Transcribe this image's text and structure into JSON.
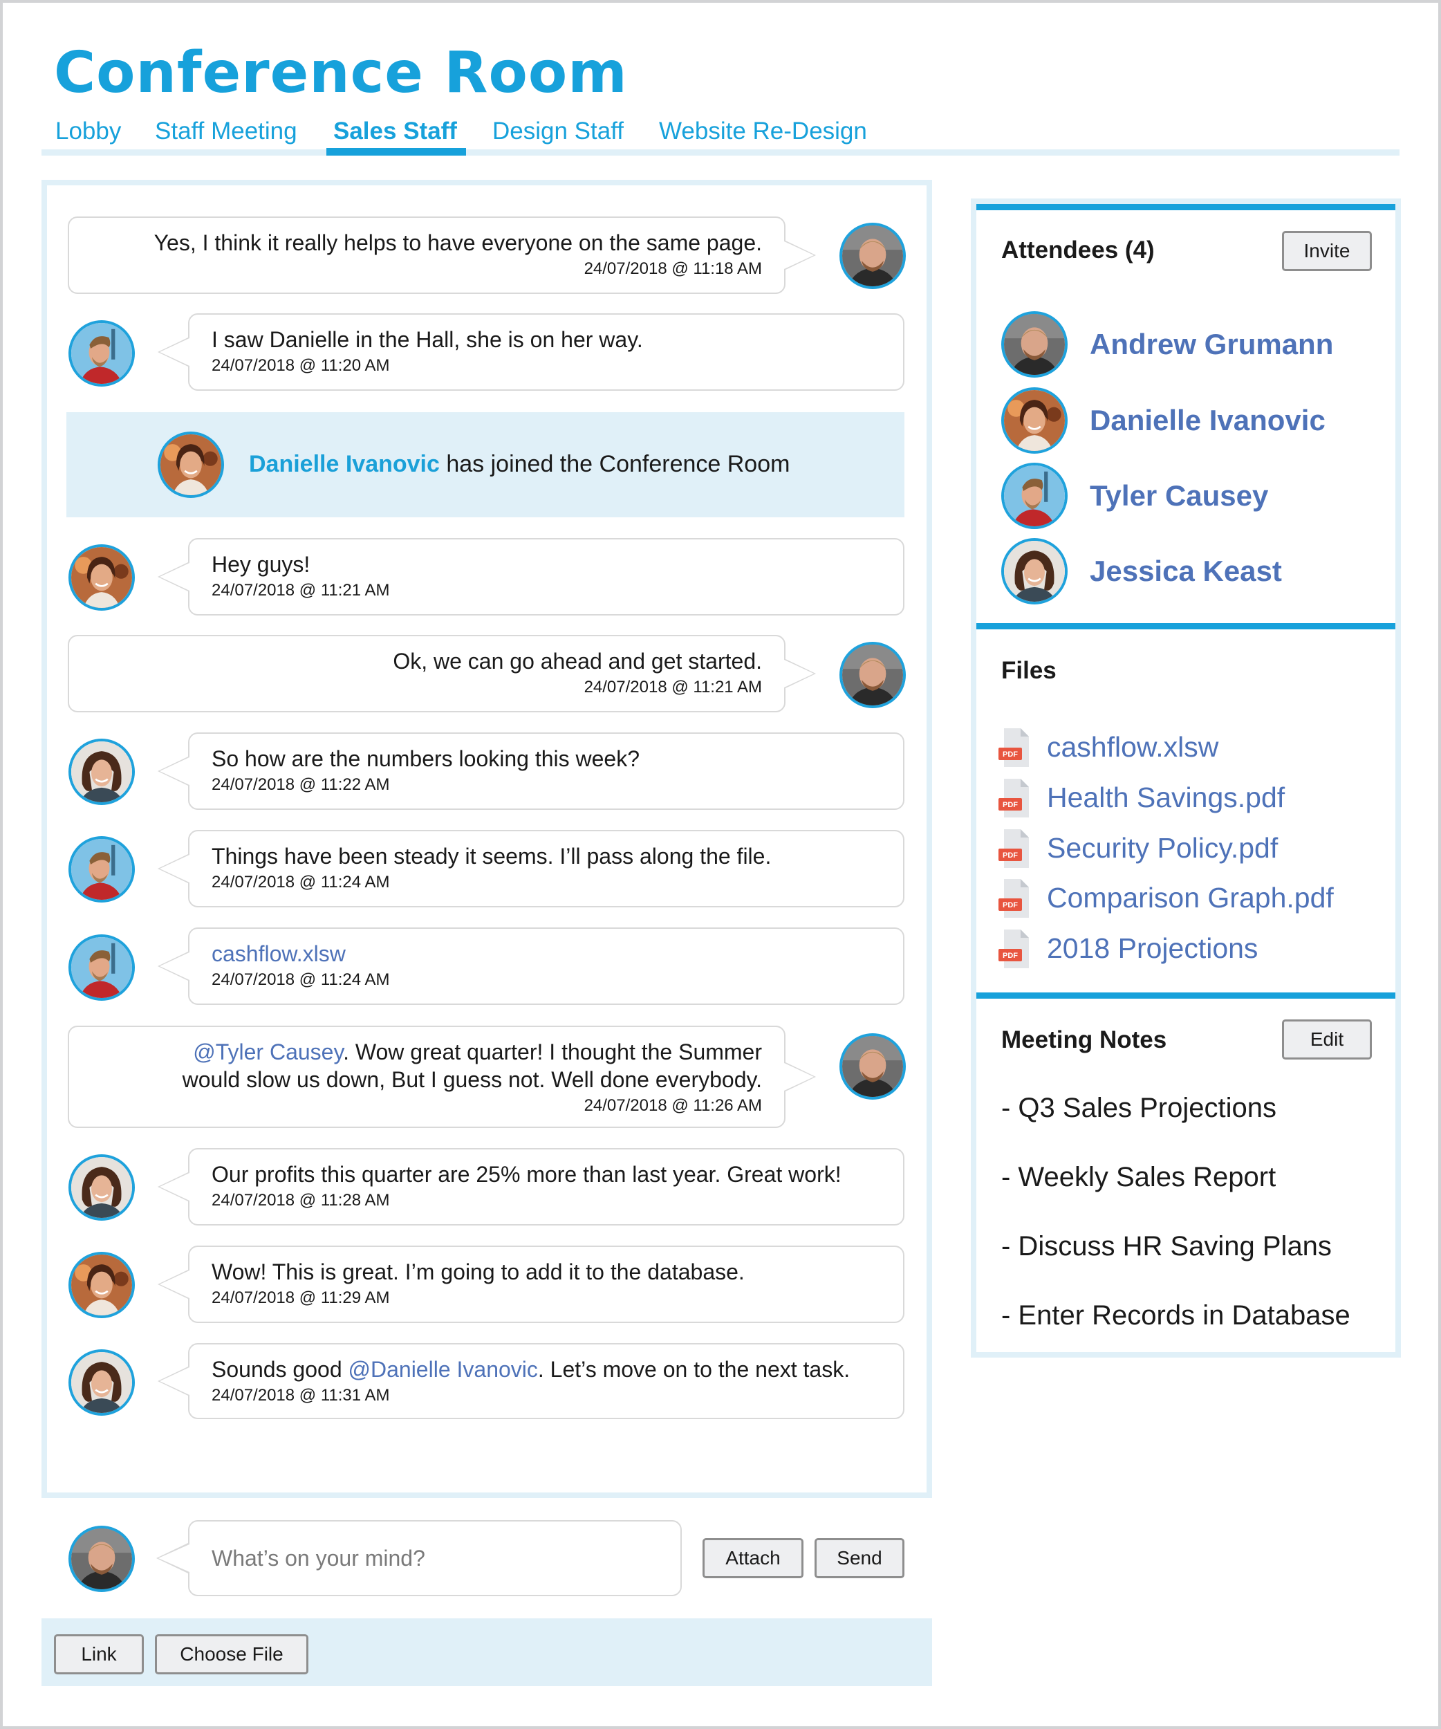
{
  "header": {
    "title": "Conference Room"
  },
  "tabs": [
    {
      "label": "Lobby",
      "active": false
    },
    {
      "label": "Staff Meeting",
      "active": false
    },
    {
      "label": "Sales Staff",
      "active": true
    },
    {
      "label": "Design Staff",
      "active": false
    },
    {
      "label": "Website Re-Design",
      "active": false
    }
  ],
  "colors": {
    "accent": "#17a1db",
    "link": "#4e72b8",
    "panel_bg": "#e0f0f8",
    "bubble_border": "#d9d9d9",
    "button_bg": "#eeeff1",
    "pdf_badge": "#e8553f"
  },
  "people": {
    "andrew": {
      "name": "Andrew Grumann",
      "avatar": "avatar-andrew"
    },
    "danielle": {
      "name": "Danielle Ivanovic",
      "avatar": "avatar-danielle"
    },
    "tyler": {
      "name": "Tyler Causey",
      "avatar": "avatar-tyler"
    },
    "jessica": {
      "name": "Jessica Keast",
      "avatar": "avatar-jessica"
    }
  },
  "messages": [
    {
      "author": "andrew",
      "side": "right",
      "text": "Yes, I think it really helps to have everyone on the same page.",
      "time": "24/07/2018  @ 11:18 AM"
    },
    {
      "author": "tyler",
      "side": "left",
      "text": "I saw Danielle in the Hall, she is on her way.",
      "time": "24/07/2018  @ 11:20 AM"
    },
    {
      "author": "danielle",
      "side": "left",
      "text": "Hey guys!",
      "time": "24/07/2018  @ 11:21 AM"
    },
    {
      "author": "andrew",
      "side": "right",
      "text": "Ok, we can go ahead and get started.",
      "time": "24/07/2018  @ 11:21 AM"
    },
    {
      "author": "jessica",
      "side": "left",
      "text": "So how are the numbers looking this week?",
      "time": "24/07/2018  @ 11:22 AM"
    },
    {
      "author": "tyler",
      "side": "left",
      "text": "Things have been steady it seems. I’ll pass along the file.",
      "time": "24/07/2018  @ 11:24 AM"
    },
    {
      "author": "tyler",
      "side": "left",
      "file": "cashflow.xlsw",
      "time": "24/07/2018  @ 11:24 AM"
    },
    {
      "author": "andrew",
      "side": "right",
      "mention": "@Tyler Causey",
      "text_line1": ". Wow great quarter! I thought the Summer",
      "text_line2": "would slow us down, But I guess not. Well done everybody.",
      "time": "24/07/2018  @ 11:26 AM"
    },
    {
      "author": "jessica",
      "side": "left",
      "text": "Our profits this quarter are 25% more than last year. Great work!",
      "time": "24/07/2018  @ 11:28 AM"
    },
    {
      "author": "danielle",
      "side": "left",
      "text": "Wow! This is great. I’m going to add it to the database.",
      "time": "24/07/2018  @ 11:29 AM"
    },
    {
      "author": "jessica",
      "side": "left",
      "text_before": "Sounds good ",
      "mention": "@Danielle Ivanovic",
      "text_after": ". Let’s move on to the next task.",
      "time": "24/07/2018  @ 11:31 AM"
    }
  ],
  "join_event": {
    "name": "Danielle Ivanovic",
    "text": " has joined the Conference Room"
  },
  "composer": {
    "placeholder": "What’s on your mind?",
    "attach_label": "Attach",
    "send_label": "Send"
  },
  "toolbar": {
    "link_label": "Link",
    "choose_file_label": "Choose File"
  },
  "attendees": {
    "title": "Attendees (4)",
    "invite_label": "Invite",
    "list": [
      "Andrew Grumann",
      "Danielle Ivanovic",
      "Tyler Causey",
      "Jessica Keast"
    ]
  },
  "files": {
    "title": "Files",
    "icon_label": "PDF",
    "list": [
      "cashflow.xlsw",
      "Health Savings.pdf",
      "Security Policy.pdf",
      "Comparison Graph.pdf",
      "2018 Projections"
    ]
  },
  "notes": {
    "title": "Meeting Notes",
    "edit_label": "Edit",
    "list": [
      "- Q3 Sales Projections",
      "- Weekly Sales Report",
      "- Discuss HR Saving Plans",
      "- Enter Records in Database"
    ]
  }
}
